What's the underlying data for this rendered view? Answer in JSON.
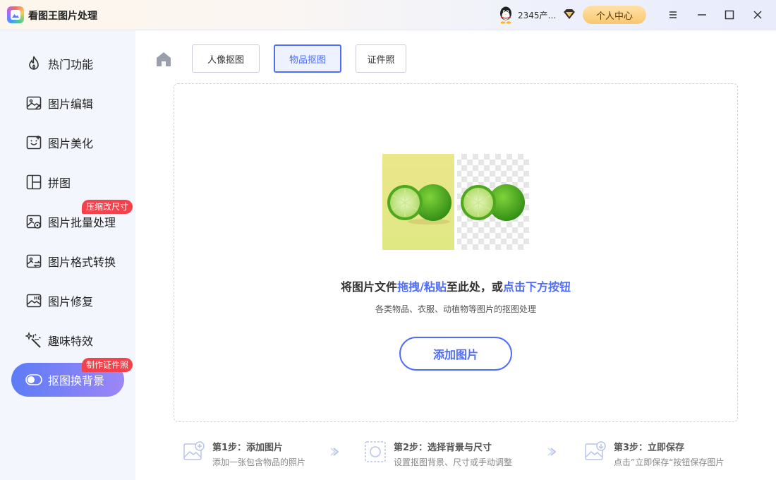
{
  "app": {
    "title": "看图王图片处理"
  },
  "header": {
    "user_name": "2345产…",
    "personal_center": "个人中心"
  },
  "sidebar": {
    "items": [
      {
        "label": "热门功能"
      },
      {
        "label": "图片编辑"
      },
      {
        "label": "图片美化"
      },
      {
        "label": "拼图"
      },
      {
        "label": "图片批量处理",
        "badge": "压缩改尺寸"
      },
      {
        "label": "图片格式转换"
      },
      {
        "label": "图片修复"
      },
      {
        "label": "趣味特效"
      },
      {
        "label": "抠图换背景",
        "badge": "制作证件照",
        "active": true
      }
    ]
  },
  "tabs": [
    {
      "label": "人像抠图"
    },
    {
      "label": "物品抠图",
      "active": true
    },
    {
      "label": "证件照"
    }
  ],
  "dropzone": {
    "title_part1": "将图片文件",
    "title_hl1": "拖拽/粘贴",
    "title_part2": "至此处，或",
    "title_hl2": "点击下方按钮",
    "subtitle": "各类物品、衣服、动植物等图片的抠图处理",
    "add_button": "添加图片"
  },
  "steps": [
    {
      "title": "第1步：添加图片",
      "desc": "添加一张包含物品的照片"
    },
    {
      "title": "第2步：选择背景与尺寸",
      "desc": "设置抠图背景、尺寸或手动调整"
    },
    {
      "title": "第3步：立即保存",
      "desc": "点击”立即保存“按钮保存图片"
    }
  ],
  "colors": {
    "accent": "#4f6ef5",
    "badge": "#f3424b",
    "sidebar_bg": "#f4f6fd"
  }
}
